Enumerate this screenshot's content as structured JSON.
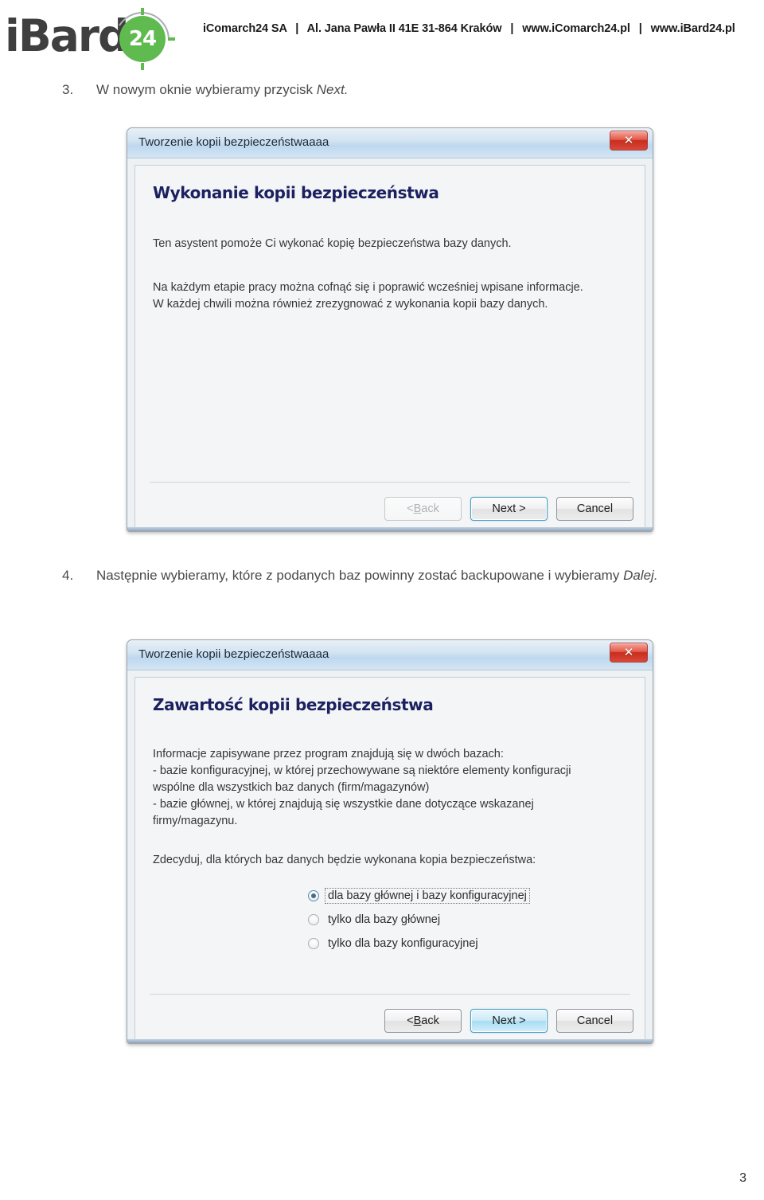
{
  "header": {
    "logo": {
      "wordmark": "iBard",
      "badge": "24",
      "arc_icon": "arc-decoration-icon"
    },
    "company": "iComarch24 SA",
    "address": "Al. Jana Pawła II 41E  31-864 Kraków",
    "site1": "www.iComarch24.pl",
    "site2": "www.iBard24.pl",
    "separator": "|"
  },
  "steps": {
    "step3": {
      "number": "3.",
      "text_before": "W nowym oknie wybieramy przycisk ",
      "emphasis": "Next",
      "text_after": "."
    },
    "step4": {
      "number": "4.",
      "text_before": "Następnie wybieramy, które z podanych baz powinny zostać backupowane i wybieramy ",
      "emphasis": "Dalej",
      "text_after": "."
    }
  },
  "dialog1": {
    "title": "Tworzenie kopii bezpieczeństwaaaa",
    "close_label": "✕",
    "heading": "Wykonanie kopii bezpieczeństwa",
    "paragraph1": "Ten asystent pomoże Ci wykonać kopię bezpieczeństwa bazy danych.",
    "paragraph2_line1": "Na każdym etapie pracy można cofnąć się i poprawić wcześniej wpisane informacje.",
    "paragraph2_line2": "W każdej chwili można również zrezygnować z wykonania kopii bazy danych.",
    "buttons": {
      "back": "< Back",
      "back_accel": "B",
      "back_prefix": "< ",
      "back_suffix": "ack",
      "next": "Next >",
      "cancel": "Cancel"
    }
  },
  "dialog2": {
    "title": "Tworzenie kopii bezpieczeństwaaaa",
    "close_label": "✕",
    "heading": "Zawartość kopii bezpieczeństwa",
    "paragraph_line1": "Informacje zapisywane przez program znajdują się w dwóch bazach:",
    "paragraph_line2": "- bazie konfiguracyjnej, w której przechowywane są niektóre elementy konfiguracji",
    "paragraph_line3": "wspólne dla wszystkich baz danych (firm/magazynów)",
    "paragraph_line4": "- bazie głównej, w której znajdują się wszystkie dane dotyczące wskazanej",
    "paragraph_line5": "firmy/magazynu.",
    "radio_prompt": "Zdecyduj, dla których baz danych będzie wykonana kopia bezpieczeństwa:",
    "radio_options": [
      {
        "label": "dla bazy głównej i bazy konfiguracyjnej",
        "selected": true
      },
      {
        "label": "tylko dla bazy głównej",
        "selected": false
      },
      {
        "label": "tylko dla bazy konfiguracyjnej",
        "selected": false
      }
    ],
    "buttons": {
      "back_prefix": "< ",
      "back_accel": "B",
      "back_suffix": "ack",
      "next": "Next >",
      "cancel": "Cancel"
    }
  },
  "footer": {
    "page_number": "3"
  },
  "colors": {
    "brand_green": "#5fbb50",
    "logo_gray": "#3f3f3f",
    "dialog_heading": "#1b2160",
    "close_red": "#c92d1c",
    "default_button_blue": "#4b9fc4"
  }
}
